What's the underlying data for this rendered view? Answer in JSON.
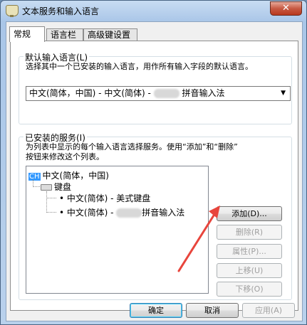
{
  "window": {
    "title": "文本服务和输入语言",
    "close_glyph": "✕"
  },
  "tabs": [
    {
      "label": "常规",
      "active": true
    },
    {
      "label": "语言栏",
      "active": false
    },
    {
      "label": "高级键设置",
      "active": false
    }
  ],
  "default_lang": {
    "label": "默认输入语言(L)",
    "description": "选择其中一个已安装的输入语言，用作所有输入字段的默认语言。",
    "combo_prefix": "中文(简体，中国) - 中文(简体) -",
    "combo_suffix": "拼音输入法",
    "arrow": "▼"
  },
  "services": {
    "label": "已安装的服务(I)",
    "description_line1": "为列表中显示的每个输入语言选择服务。使用“添加”和“删除”",
    "description_line2": "按钮来修改这个列表。",
    "tree": {
      "badge": "CH",
      "language": "中文(简体，中国)",
      "keyboard": "键盘",
      "items": [
        {
          "prefix": "• 中文(简体) - 美式键盘",
          "suffix": ""
        },
        {
          "prefix": "• 中文(简体) -",
          "suffix": "拼音输入法"
        }
      ]
    },
    "buttons": {
      "add": "添加(D)...",
      "remove": "删除(R)",
      "properties": "属性(P)...",
      "move_up": "上移(U)",
      "move_down": "下移(O)"
    }
  },
  "footer": {
    "ok": "确定",
    "cancel": "取消",
    "apply": "应用(A)"
  },
  "colors": {
    "badge": "#3399ff",
    "arrow": "#e8453c"
  }
}
